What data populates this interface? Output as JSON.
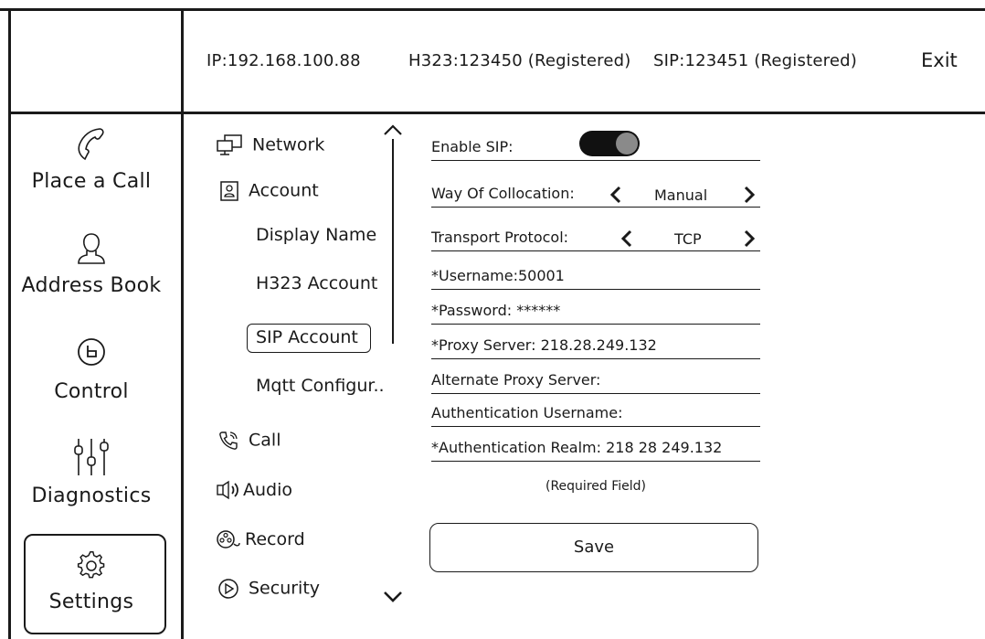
{
  "header": {
    "ip": "IP:192.168.100.88",
    "h323": "H323:123450 (Registered)",
    "sip": "SIP:123451 (Registered)",
    "exit": "Exit"
  },
  "rail": {
    "items": [
      {
        "label": "Place a Call",
        "icon": "phone-icon"
      },
      {
        "label": "Address Book",
        "icon": "person-icon"
      },
      {
        "label": "Control",
        "icon": "control-icon"
      },
      {
        "label": "Diagnostics",
        "icon": "sliders-icon"
      },
      {
        "label": "Settings",
        "icon": "gear-icon",
        "selected": true
      }
    ]
  },
  "menu": {
    "network": "Network",
    "account": "Account",
    "account_sub": [
      "Display Name",
      "H323 Account",
      "SIP Account",
      "Mqtt Configur.."
    ],
    "selected_sub": "SIP Account",
    "call": "Call",
    "audio": "Audio",
    "record": "Record",
    "security": "Security"
  },
  "form": {
    "enable_sip_label": "Enable SIP:",
    "enable_sip_on": true,
    "way_label": "Way Of Collocation:",
    "way_value": "Manual",
    "transport_label": "Transport Protocol:",
    "transport_value": "TCP",
    "username": "*Username:50001",
    "password": "*Password: ******",
    "proxy": "*Proxy Server: 218.28.249.132",
    "alt_proxy": "Alternate Proxy Server:",
    "auth_user": "Authentication Username:",
    "auth_realm": "*Authentication Realm: 218 28 249.132",
    "required_note": "(Required Field)",
    "save_label": "Save"
  }
}
